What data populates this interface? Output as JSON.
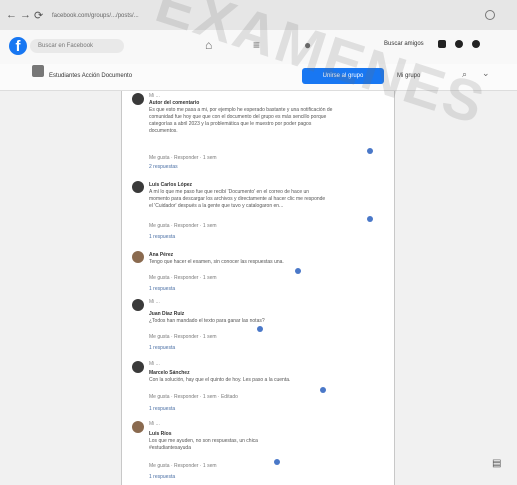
{
  "browser": {
    "url": "facebook.com/groups/.../posts/...",
    "nav": [
      "←",
      "→",
      "⟳"
    ]
  },
  "appbar": {
    "search_placeholder": "Buscar en Facebook",
    "profile_name": "Buscar amigos"
  },
  "group": {
    "name": "Estudiantes Acción Documento",
    "join_label": "Unirse al grupo",
    "notification_label": "Mi grupo"
  },
  "comments": [
    {
      "meta": "Mi ...",
      "author": "Autor del comentario",
      "lines": [
        "Es que esto me pasa a mi, por ejemplo he esperado bastante y una notificación de",
        "comunidad fue hoy que que con el documento del grupo es más sencillo porque",
        "categorías a abril 2023 y la problemática que le muestro por poder pagos",
        "documentos."
      ],
      "actions": "Me gusta · Responder · 1 sem",
      "replies": "2 respuestas"
    },
    {
      "meta": "",
      "author": "Luis Carlos López",
      "lines": [
        "A mí lo que me paso fue que recibí 'Documento' en el correo de hace un",
        "momento para descargar los archivos y directamente al hacer clic me responde",
        "el 'Cuidador' después a la gente que tuvo y catalogaron en..."
      ],
      "actions": "Me gusta · Responder · 1 sem",
      "replies": "1 respuesta"
    },
    {
      "meta": "",
      "author": "Ana Pérez",
      "lines": [
        "Tengo que hacer el examen, sin conocer las respuestas una."
      ],
      "actions": "Me gusta · Responder · 1 sem",
      "replies": "1 respuesta"
    },
    {
      "meta": "Mi ...",
      "author": "Juan Díaz Ruiz",
      "lines": [
        "¿Todos han mandado el texto para ganar las notas?"
      ],
      "actions": "Me gusta · Responder · 1 sem",
      "replies": "1 respuesta"
    },
    {
      "meta": "Mi ...",
      "author": "Marcelo Sánchez",
      "lines": [
        "Con la solución, hay que el quinto de hoy. Les paso a la cuenta."
      ],
      "actions": "Me gusta · Responder · 1 sem · Editado",
      "replies": "1 respuesta"
    },
    {
      "meta": "Mi ...",
      "author": "Luis Ríos",
      "lines": [
        "Los que me ayuden, no son respuestas, un chica",
        "#estudiantesayuda"
      ],
      "actions": "Me gusta · Responder · 1 sem",
      "replies": "1 respuesta"
    }
  ],
  "watermark": "EXAMENES"
}
